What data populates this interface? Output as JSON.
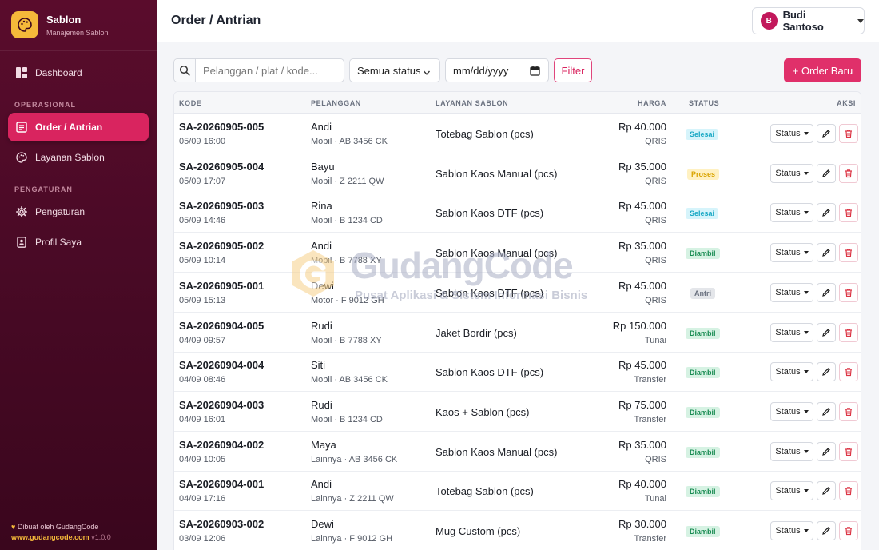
{
  "brand": {
    "title": "Sablon",
    "subtitle": "Manajemen Sablon",
    "logo_icon": "palette-icon",
    "accent": "#f5b93a"
  },
  "sidebar": {
    "dashboard": {
      "label": "Dashboard",
      "icon": "dashboard-icon"
    },
    "section_operasional": "OPERASIONAL",
    "orders": {
      "label": "Order / Antrian",
      "icon": "list-icon",
      "active": true
    },
    "services": {
      "label": "Layanan Sablon",
      "icon": "palette-icon"
    },
    "section_pengaturan": "PENGATURAN",
    "settings": {
      "label": "Pengaturan",
      "icon": "gear-icon"
    },
    "profile": {
      "label": "Profil Saya",
      "icon": "badge-icon"
    },
    "footer": {
      "made_by": "Dibuat oleh GudangCode",
      "url": "www.gudangcode.com",
      "version": "v1.0.0"
    }
  },
  "header": {
    "title": "Order / Antrian",
    "user": {
      "initial": "B",
      "name": "Budi Santoso"
    }
  },
  "toolbar": {
    "search_placeholder": "Pelanggan / plat / kode...",
    "status_selected": "Semua status",
    "date_placeholder": "mm/dd/yyyy",
    "filter_label": "Filter",
    "new_order_label": "+ Order Baru"
  },
  "table": {
    "headers": {
      "code": "KODE",
      "customer": "PELANGGAN",
      "service": "LAYANAN SABLON",
      "price": "HARGA",
      "status": "STATUS",
      "action": "AKSI"
    },
    "action_status_label": "Status",
    "rows": [
      {
        "code": "SA-20260905-005",
        "date": "05/09 16:00",
        "name": "Andi",
        "vehicle": "Mobil · AB 3456 CK",
        "service": "Totebag Sablon (pcs)",
        "price": "Rp 40.000",
        "payment": "QRIS",
        "status": "Selesai"
      },
      {
        "code": "SA-20260905-004",
        "date": "05/09 17:07",
        "name": "Bayu",
        "vehicle": "Mobil · Z 2211 QW",
        "service": "Sablon Kaos Manual (pcs)",
        "price": "Rp 35.000",
        "payment": "QRIS",
        "status": "Proses"
      },
      {
        "code": "SA-20260905-003",
        "date": "05/09 14:46",
        "name": "Rina",
        "vehicle": "Mobil · B 1234 CD",
        "service": "Sablon Kaos DTF (pcs)",
        "price": "Rp 45.000",
        "payment": "QRIS",
        "status": "Selesai"
      },
      {
        "code": "SA-20260905-002",
        "date": "05/09 10:14",
        "name": "Andi",
        "vehicle": "Mobil · B 7788 XY",
        "service": "Sablon Kaos Manual (pcs)",
        "price": "Rp 35.000",
        "payment": "QRIS",
        "status": "Diambil"
      },
      {
        "code": "SA-20260905-001",
        "date": "05/09 15:13",
        "name": "Dewi",
        "vehicle": "Motor · F 9012 GH",
        "service": "Sablon Kaos DTF (pcs)",
        "price": "Rp 45.000",
        "payment": "QRIS",
        "status": "Antri"
      },
      {
        "code": "SA-20260904-005",
        "date": "04/09 09:57",
        "name": "Rudi",
        "vehicle": "Mobil · B 7788 XY",
        "service": "Jaket Bordir (pcs)",
        "price": "Rp 150.000",
        "payment": "Tunai",
        "status": "Diambil"
      },
      {
        "code": "SA-20260904-004",
        "date": "04/09 08:46",
        "name": "Siti",
        "vehicle": "Mobil · AB 3456 CK",
        "service": "Sablon Kaos DTF (pcs)",
        "price": "Rp 45.000",
        "payment": "Transfer",
        "status": "Diambil"
      },
      {
        "code": "SA-20260904-003",
        "date": "04/09 16:01",
        "name": "Rudi",
        "vehicle": "Mobil · B 1234 CD",
        "service": "Kaos + Sablon (pcs)",
        "price": "Rp 75.000",
        "payment": "Transfer",
        "status": "Diambil"
      },
      {
        "code": "SA-20260904-002",
        "date": "04/09 10:05",
        "name": "Maya",
        "vehicle": "Lainnya · AB 3456 CK",
        "service": "Sablon Kaos Manual (pcs)",
        "price": "Rp 35.000",
        "payment": "QRIS",
        "status": "Diambil"
      },
      {
        "code": "SA-20260904-001",
        "date": "04/09 17:16",
        "name": "Andi",
        "vehicle": "Lainnya · Z 2211 QW",
        "service": "Totebag Sablon (pcs)",
        "price": "Rp 40.000",
        "payment": "Tunai",
        "status": "Diambil"
      },
      {
        "code": "SA-20260903-002",
        "date": "03/09 12:06",
        "name": "Dewi",
        "vehicle": "Lainnya · F 9012 GH",
        "service": "Mug Custom (pcs)",
        "price": "Rp 30.000",
        "payment": "Transfer",
        "status": "Diambil"
      }
    ]
  },
  "watermark": {
    "title": "GudangCode",
    "subtitle": "Pusat Aplikasi & Sistem Informasi Bisnis"
  },
  "colors": {
    "primary": "#d9245f",
    "sidebar": "#4a0a26",
    "selesai": "#1aa8c4",
    "proses": "#d9a400",
    "diambil": "#168a50",
    "antri": "#6b7280"
  }
}
